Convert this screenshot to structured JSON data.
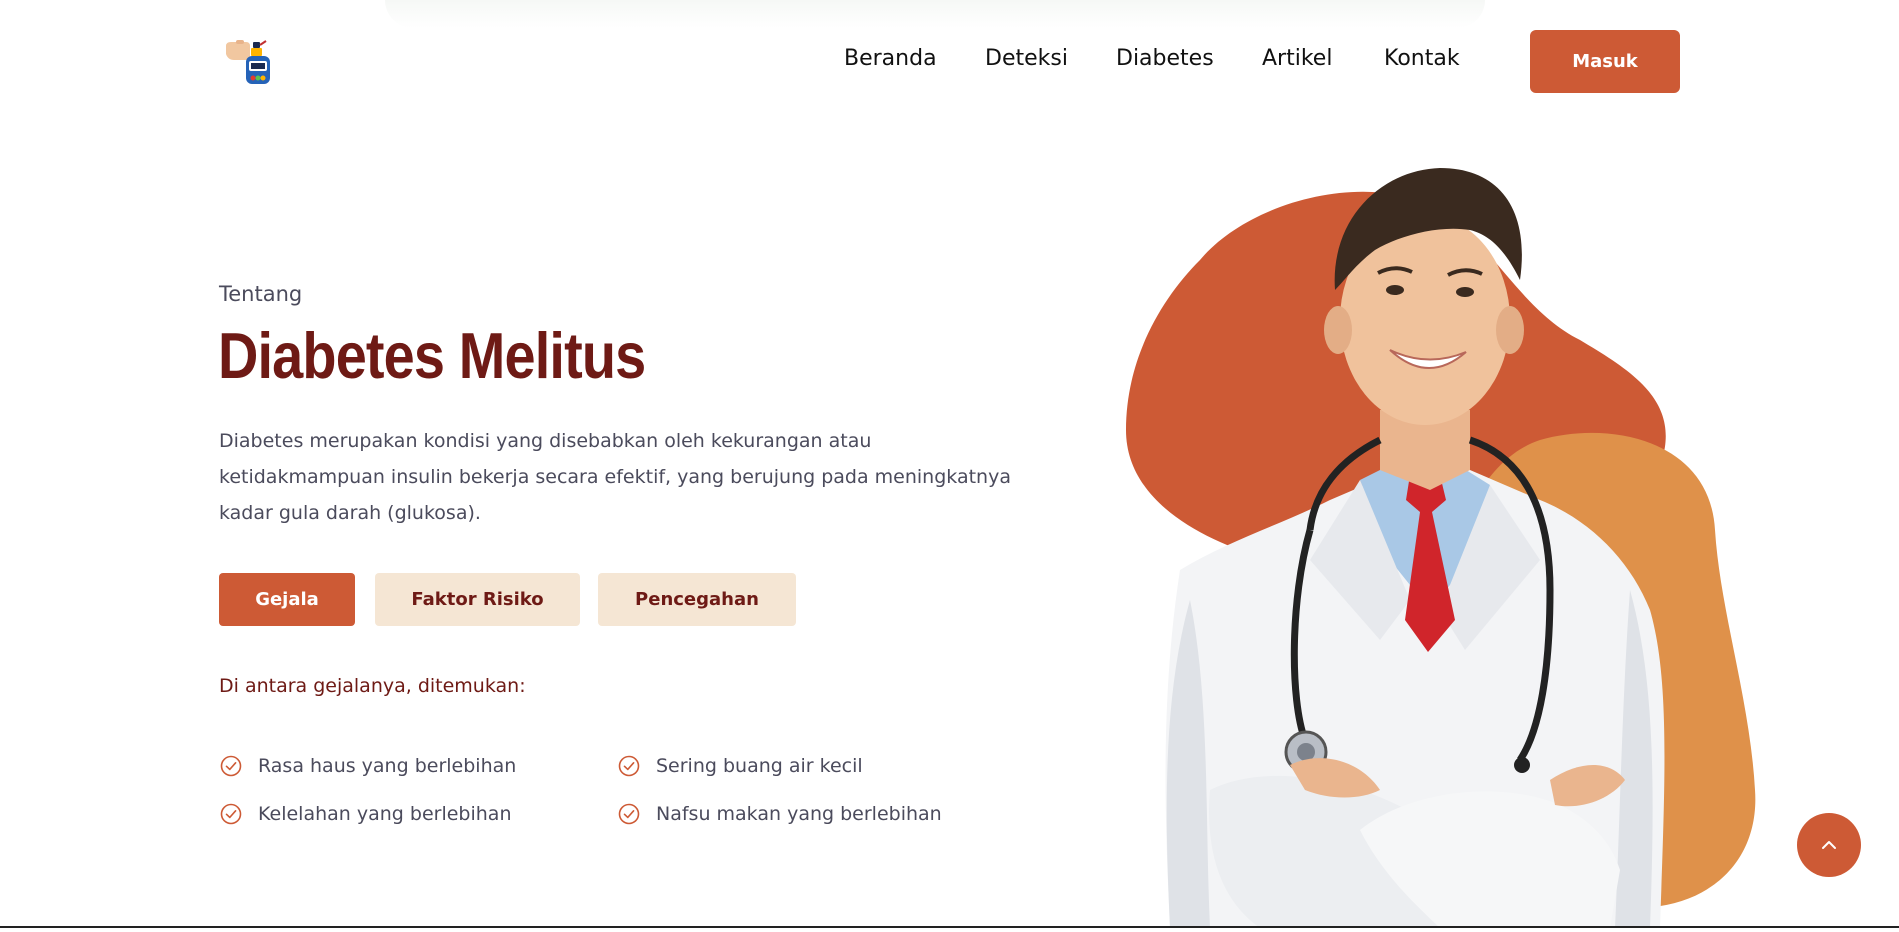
{
  "header": {
    "nav": [
      {
        "label": "Beranda"
      },
      {
        "label": "Deteksi"
      },
      {
        "label": "Diabetes"
      },
      {
        "label": "Artikel"
      },
      {
        "label": "Kontak"
      }
    ],
    "login_label": "Masuk"
  },
  "about": {
    "eyebrow": "Tentang",
    "title": "Diabetes Melitus",
    "description": "Diabetes merupakan kondisi yang disebabkan oleh kekurangan atau ketidakmampuan insulin bekerja secara efektif, yang berujung pada meningkatnya kadar gula darah (glukosa).",
    "tabs": [
      {
        "label": "Gejala",
        "active": true
      },
      {
        "label": "Faktor Risiko",
        "active": false
      },
      {
        "label": "Pencegahan",
        "active": false
      }
    ],
    "lead": "Di antara gejalanya, ditemukan:",
    "symptoms": [
      "Rasa haus yang berlebihan",
      "Sering buang air kecil",
      "Kelelahan yang berlebihan",
      "Nafsu makan yang berlebihan"
    ]
  },
  "icons": {
    "logo": "glucometer-logo-icon",
    "check": "check-circle-icon",
    "scroll_top": "chevron-up-icon"
  },
  "colors": {
    "primary": "#cd5a35",
    "title": "#6e1a15",
    "tab_inactive_bg": "#f5e6d4",
    "blob_orange": "#cd5a35",
    "blob_amber": "#df914a"
  }
}
